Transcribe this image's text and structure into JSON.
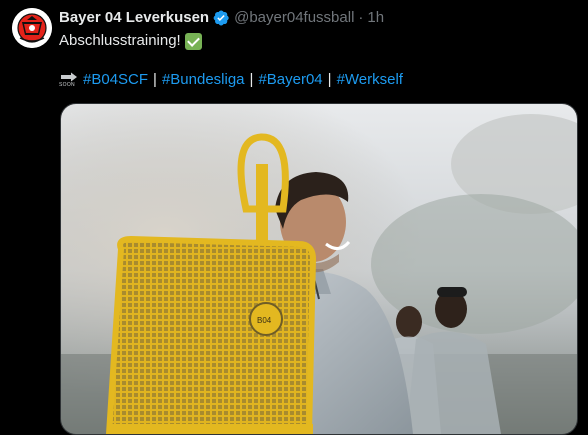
{
  "tweet": {
    "display_name": "Bayer 04 Leverkusen",
    "handle": "@bayer04fussball",
    "separator": "·",
    "time": "1h",
    "text": "Abschlusstraining!",
    "hashtag_prefix_icon": "soon-arrow-icon",
    "hashtag_prefix_label": "SOON",
    "hashtags": [
      "#B04SCF",
      "#Bundesliga",
      "#Bayer04",
      "#Werkself"
    ],
    "hashtag_separator": "|",
    "media_logo_text": "B04"
  },
  "colors": {
    "background": "#000000",
    "primary_text": "#e7e9ea",
    "secondary_text": "#71767b",
    "link": "#1d9bf0",
    "verified": "#1d9bf0",
    "checkmark_emoji": "#77b255",
    "dummy_yellow": "#e3b820"
  },
  "icons": {
    "avatar": "bayer04-crest-icon",
    "verified": "verified-badge-icon",
    "emoji": "check-mark-button-emoji"
  }
}
